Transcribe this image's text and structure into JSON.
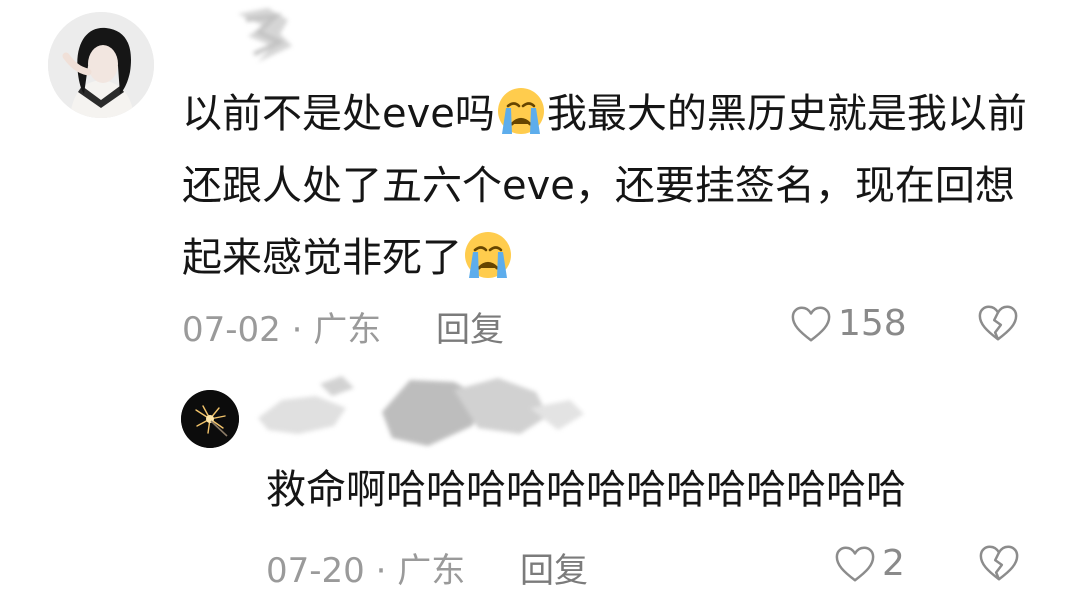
{
  "comment": {
    "avatar_icon": "user-avatar-photo",
    "text_part1": "以前不是处eve吗",
    "text_part2": "我最大的黑历史就是我以前还跟人处了五六个eve，还要挂签名，现在回想起来感觉非死了",
    "emoji_icon": "loudly-crying-face-emoji",
    "date": "07-02",
    "separator": "·",
    "location": "广东",
    "reply_label": "回复",
    "like_count": "158",
    "like_icon": "heart-outline-icon",
    "dislike_icon": "broken-heart-icon"
  },
  "reply": {
    "avatar_icon": "sparkler-avatar",
    "text": "救命啊哈哈哈哈哈哈哈哈哈哈哈哈哈",
    "date": "07-20",
    "separator": "·",
    "location": "广东",
    "reply_label": "回复",
    "like_count": "2",
    "like_icon": "heart-outline-icon",
    "dislike_icon": "broken-heart-icon"
  },
  "colors": {
    "text": "#151515",
    "meta": "#9a9a9a",
    "emoji_face": "#ffcc4d",
    "emoji_tears": "#5dadec"
  }
}
